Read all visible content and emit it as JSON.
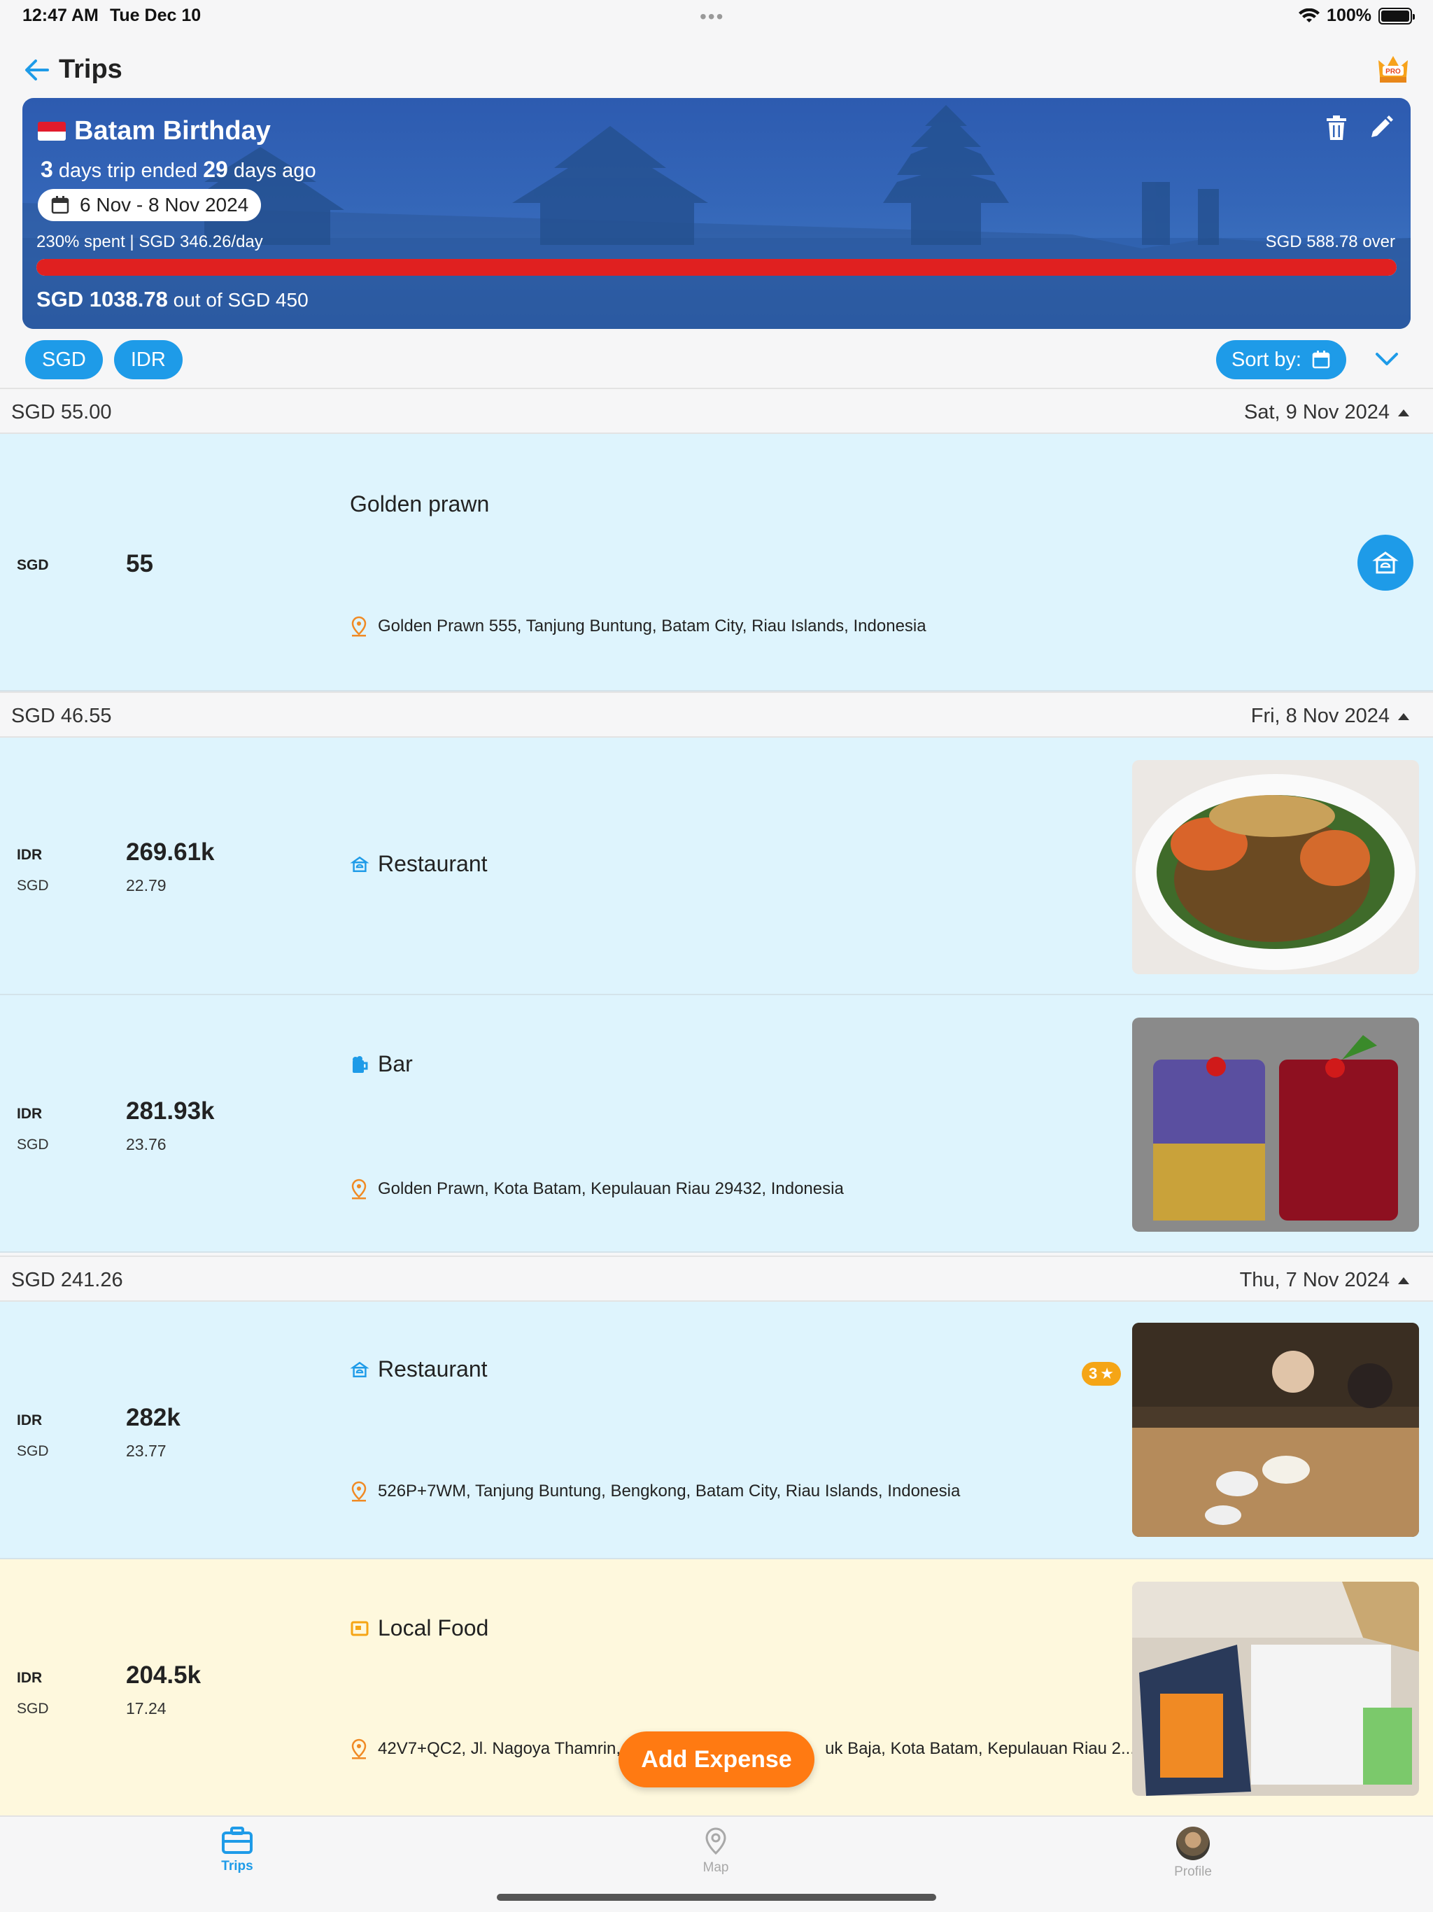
{
  "status_bar": {
    "time": "12:47 AM",
    "date": "Tue Dec 10",
    "dots": "•••",
    "battery": "100%"
  },
  "header": {
    "title": "Trips",
    "pro_icon": "pro-crown-icon"
  },
  "trip": {
    "name": "Batam Birthday",
    "days": "3",
    "days_text": " days trip ended ",
    "ago": "29",
    "ago_text": " days ago",
    "date_range": "6 Nov - 8 Nov 2024",
    "stats": "230% spent | SGD 346.26/day",
    "over": "SGD 588.78 over",
    "total": "SGD 1038.78",
    "out_of": " out of SGD 450",
    "spent_fraction": 1.0,
    "progress_color": "#e02020"
  },
  "chips": [
    "SGD",
    "IDR"
  ],
  "sort_label": "Sort by:",
  "groups": [
    {
      "total": "SGD 55.00",
      "date": "Sat, 9 Nov 2024"
    },
    {
      "total": "SGD 46.55",
      "date": "Fri, 8 Nov 2024"
    },
    {
      "total": "SGD 241.26",
      "date": "Thu, 7 Nov 2024"
    }
  ],
  "expenses": [
    {
      "cur_main": "SGD",
      "amt_main": "55",
      "title": "Golden prawn",
      "location": "Golden Prawn 555, Tanjung Buntung, Batam City, Riau Islands, Indonesia"
    },
    {
      "cur_main": "IDR",
      "amt_main": "269.61k",
      "cur_sub": "SGD",
      "amt_sub": "22.79",
      "title": "Restaurant"
    },
    {
      "cur_main": "IDR",
      "amt_main": "281.93k",
      "cur_sub": "SGD",
      "amt_sub": "23.76",
      "title": "Bar",
      "location": "Golden Prawn, Kota Batam, Kepulauan Riau 29432, Indonesia"
    },
    {
      "cur_main": "IDR",
      "amt_main": "282k",
      "cur_sub": "SGD",
      "amt_sub": "23.77",
      "title": "Restaurant",
      "rating": "3",
      "location": "526P+7WM, Tanjung Buntung, Bengkong, Batam City, Riau Islands, Indonesia"
    },
    {
      "cur_main": "IDR",
      "amt_main": "204.5k",
      "cur_sub": "SGD",
      "amt_sub": "17.24",
      "title": "Local Food",
      "location_left": "42V7+QC2, Jl. Nagoya Thamrin,",
      "location_right": "uk Baja, Kota Batam, Kepulauan Riau 2..."
    }
  ],
  "add_expense": "Add Expense",
  "tabs": [
    {
      "label": "Trips",
      "icon": "briefcase-icon"
    },
    {
      "label": "Map",
      "icon": "map-pin-icon"
    },
    {
      "label": "Profile",
      "icon": "avatar"
    }
  ],
  "colors": {
    "accent": "#1e9be8",
    "orange": "#ff7a12",
    "row_blue": "#def4fd",
    "row_yellow": "#fef8dd"
  }
}
